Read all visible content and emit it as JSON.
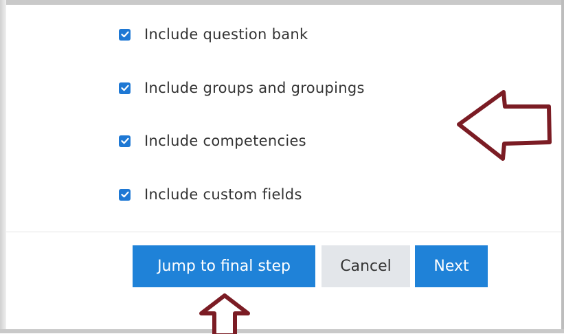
{
  "options": [
    {
      "label": "Include question bank",
      "checked": true
    },
    {
      "label": "Include groups and groupings",
      "checked": true
    },
    {
      "label": "Include competencies",
      "checked": true
    },
    {
      "label": "Include custom fields",
      "checked": true
    }
  ],
  "buttons": {
    "jump_label": "Jump to final step",
    "cancel_label": "Cancel",
    "next_label": "Next"
  },
  "colors": {
    "accent": "#1f82d8",
    "checkbox": "#1e78d4",
    "secondary_button": "#e3e6ea",
    "annotation_arrow": "#7b1c24"
  },
  "icons": {
    "checkbox": "checkmark-icon",
    "annotation_right": "left-pointing-arrow-icon",
    "annotation_bottom": "up-pointing-arrow-icon"
  }
}
